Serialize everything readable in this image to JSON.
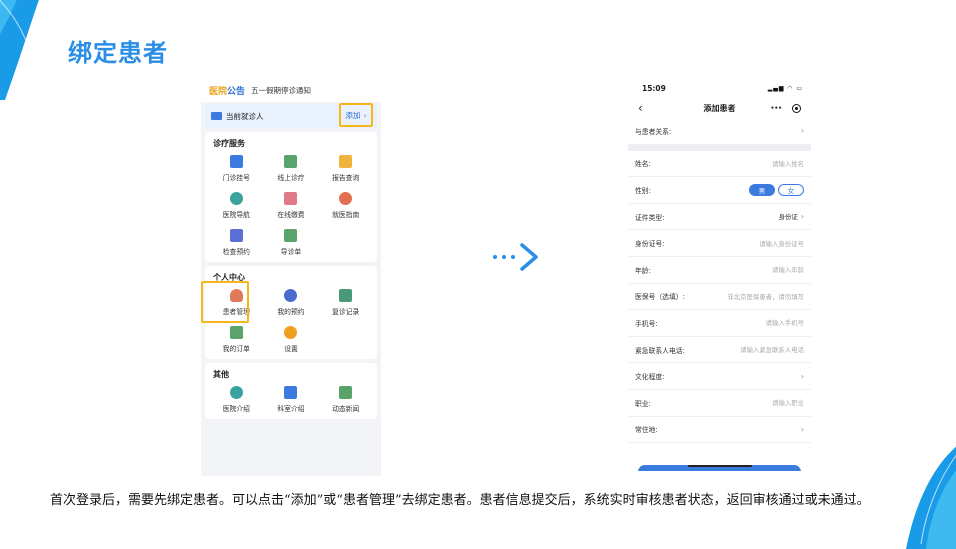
{
  "slide": {
    "title": "绑定患者",
    "caption": "首次登录后，需要先绑定患者。可以点击“添加”或“患者管理”去绑定患者。患者信息提交后，系统实时审核患者状态，返回审核通过或未通过。"
  },
  "left_screen": {
    "logo_part1": "医院",
    "logo_part2": "公告",
    "notice": "五一假期停诊通知",
    "current_patient_label": "当前就诊人",
    "add_label": "添加",
    "sections": [
      {
        "title": "诊疗服务",
        "items": [
          {
            "label": "门诊挂号",
            "icon": "calendar-icon",
            "color": "#3b7be0"
          },
          {
            "label": "线上诊疗",
            "icon": "video-chat-icon",
            "color": "#5aa36a"
          },
          {
            "label": "报告查询",
            "icon": "report-icon",
            "color": "#f0b43c"
          },
          {
            "label": "医院导航",
            "icon": "location-pin-icon",
            "color": "#3aa39a"
          },
          {
            "label": "在线缴费",
            "icon": "payment-icon",
            "color": "#e07a8a"
          },
          {
            "label": "就医指南",
            "icon": "compass-icon",
            "color": "#e07050"
          },
          {
            "label": "检查预约",
            "icon": "clipboard-icon",
            "color": "#5b6fd6"
          },
          {
            "label": "导诊单",
            "icon": "guide-sheet-icon",
            "color": "#5aa36a"
          }
        ]
      },
      {
        "title": "个人中心",
        "items": [
          {
            "label": "患者管理",
            "icon": "patient-icon",
            "color": "#e07a5a"
          },
          {
            "label": "我的预约",
            "icon": "clock-icon",
            "color": "#4a6ccf"
          },
          {
            "label": "复诊记录",
            "icon": "record-icon",
            "color": "#4a9a7a"
          },
          {
            "label": "我的订单",
            "icon": "order-icon",
            "color": "#5aa36a"
          },
          {
            "label": "设置",
            "icon": "settings-icon",
            "color": "#f0a020"
          }
        ]
      },
      {
        "title": "其他",
        "items": [
          {
            "label": "医院介绍",
            "icon": "hospital-cross-icon",
            "color": "#3aa3a0"
          },
          {
            "label": "科室介绍",
            "icon": "department-icon",
            "color": "#3b7be0"
          },
          {
            "label": "动态新闻",
            "icon": "news-icon",
            "color": "#5aa36a"
          }
        ]
      }
    ]
  },
  "right_screen": {
    "time": "15:09",
    "title": "添加患者",
    "more_label": "•••",
    "relation_label": "与患者关系:",
    "rows": [
      {
        "label": "姓名:",
        "value": "请输入姓名"
      },
      {
        "label": "性别:",
        "male": "男",
        "female": "女"
      },
      {
        "label": "证件类型:",
        "value": "身份证"
      },
      {
        "label": "身份证号:",
        "value": "请输入身份证号"
      },
      {
        "label": "年龄:",
        "value": "请输入年龄"
      },
      {
        "label": "医保号（选填）:",
        "value": "非北京医保患者，请勿填写"
      },
      {
        "label": "手机号:",
        "value": "请输入手机号"
      },
      {
        "label": "紧急联系人电话:",
        "value": "请输入紧急联系人电话"
      },
      {
        "label": "文化程度:",
        "value": ""
      },
      {
        "label": "职业:",
        "value": "请输入职业"
      },
      {
        "label": "常住地:",
        "value": ""
      }
    ]
  },
  "colors": {
    "accent": "#2a8ee6",
    "highlight": "#f5b71c",
    "button_blue": "#3b7be0"
  }
}
